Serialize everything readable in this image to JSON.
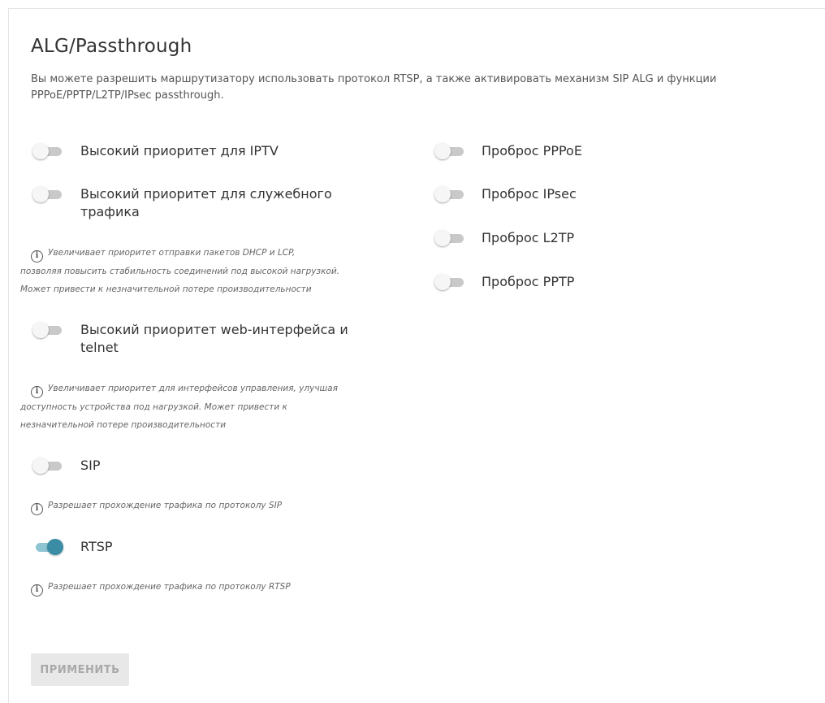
{
  "page": {
    "title": "ALG/Passthrough",
    "description": "Вы можете разрешить маршрутизатору использовать протокол RTSP, а также активировать механизм SIP ALG и функции PPPoE/PPTP/L2TP/IPsec passthrough."
  },
  "left": {
    "iptv": {
      "label": "Высокий приоритет для IPTV",
      "enabled": false
    },
    "service": {
      "label_line1": "Высокий приоритет для служебного",
      "label_line2": "трафика",
      "enabled": false,
      "hint_line1": "Увеличивает приоритет отправки пакетов DHCP и LCP,",
      "hint_line2": "позволяя повысить стабильность соединений под высокой нагрузкой.",
      "hint_line3": "Может привести к незначительной потере производительности"
    },
    "web": {
      "label_line1": "Высокий приоритет web-интерфейса и",
      "label_line2": "telnet",
      "enabled": false,
      "hint_line1": "Увеличивает приоритет для интерфейсов управления, улучшая",
      "hint_line2": "доступность устройства под нагрузкой. Может привести к",
      "hint_line3": "незначительной потере производительности"
    },
    "sip": {
      "label": "SIP",
      "enabled": false,
      "hint": "Разрешает прохождение трафика по протоколу SIP"
    },
    "rtsp": {
      "label": "RTSP",
      "enabled": true,
      "hint": "Разрешает прохождение трафика по протоколу RTSP"
    }
  },
  "right": {
    "pppoe": {
      "label": "Проброс PPPoE",
      "enabled": false
    },
    "ipsec": {
      "label": "Проброс IPsec",
      "enabled": false
    },
    "l2tp": {
      "label": "Проброс L2TP",
      "enabled": false
    },
    "pptp": {
      "label": "Проброс PPTP",
      "enabled": false
    }
  },
  "info_icon_glyph": "i",
  "actions": {
    "apply_label": "ПРИМЕНИТЬ"
  },
  "colors": {
    "toggle_on": "#3a8da4",
    "toggle_on_track": "#8ec5d3",
    "toggle_off_track": "#c9c9c9"
  }
}
